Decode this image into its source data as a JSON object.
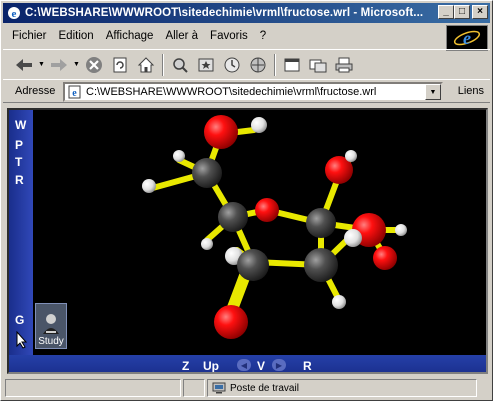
{
  "window": {
    "title": "C:\\WEBSHARE\\WWWROOT\\sitedechimie\\vrml\\fructose.wrl - Microsoft..."
  },
  "menu": {
    "items": [
      {
        "label": "Fichier"
      },
      {
        "label": "Edition"
      },
      {
        "label": "Affichage"
      },
      {
        "label": "Aller à"
      },
      {
        "label": "Favoris"
      },
      {
        "label": "?"
      }
    ]
  },
  "toolbar": {
    "buttons": [
      "back-icon",
      "forward-icon",
      "stop-icon",
      "refresh-icon",
      "home-icon",
      "search-icon",
      "favorites-icon",
      "history-icon",
      "channels-icon",
      "fullscreen-icon",
      "mail-icon",
      "print-icon"
    ]
  },
  "address": {
    "label": "Adresse",
    "value": "C:\\WEBSHARE\\WWWROOT\\sitedechimie\\vrml\\fructose.wrl",
    "links_label": "Liens"
  },
  "viewer": {
    "side_letters": [
      "W",
      "P",
      "T",
      "R"
    ],
    "g_label": "G",
    "study_label": "Study",
    "nav": {
      "z": "Z",
      "up": "Up",
      "v": "V",
      "r": "R"
    }
  },
  "status": {
    "zone": "Poste de travail"
  },
  "colors": {
    "titlebar_start": "#0a246a",
    "titlebar_end": "#3a6ea5",
    "panel_blue": "#1a2e8c",
    "oxygen": "#e01010",
    "carbon": "#444444",
    "hydrogen": "#f0f0f0",
    "bond": "#e8e800"
  }
}
